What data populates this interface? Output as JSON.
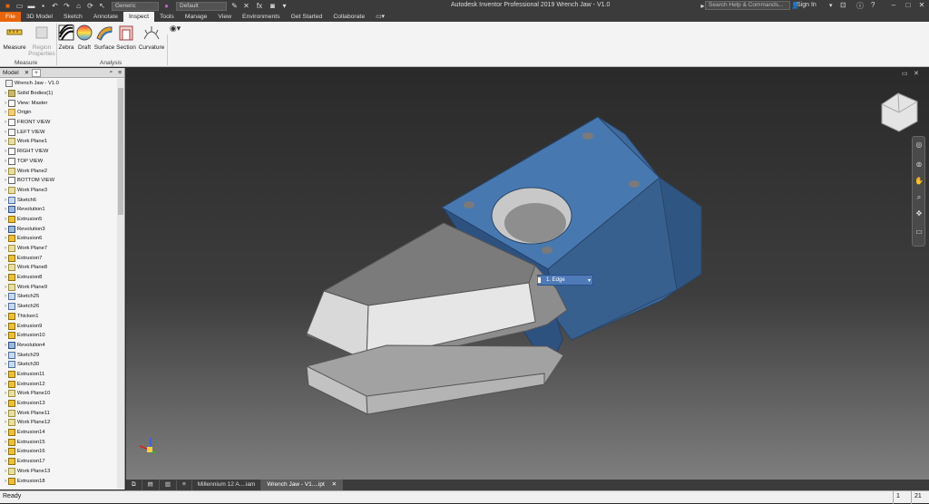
{
  "titlebar": {
    "app_title": "Autodesk Inventor Professional 2019   Wrench Jaw - V1.0",
    "appearance_combo": "Generic",
    "material_combo": "Default",
    "search_placeholder": "Search Help & Commands...",
    "signin": "Sign In"
  },
  "ribbon_tabs": [
    "3D Model",
    "Sketch",
    "Annotate",
    "Inspect",
    "Tools",
    "Manage",
    "View",
    "Environments",
    "Get Started",
    "Collaborate"
  ],
  "file_tab": "File",
  "ribbon": {
    "measure": "Measure",
    "region_properties_1": "Region",
    "region_properties_2": "Properties",
    "zebra": "Zebra",
    "draft": "Draft",
    "surface": "Surface",
    "section": "Section",
    "curvature": "Curvature",
    "group_measure": "Measure",
    "group_analysis": "Analysis"
  },
  "browser": {
    "tab": "Model",
    "add": "+",
    "items": [
      {
        "label": "Wrench Jaw - V1.0",
        "icon": "part",
        "indent": 0
      },
      {
        "label": "Solid Bodies(1)",
        "icon": "body",
        "indent": 1
      },
      {
        "label": "View: Master",
        "icon": "view",
        "indent": 1
      },
      {
        "label": "Origin",
        "icon": "folder",
        "indent": 1
      },
      {
        "label": "FRONT VIEW",
        "icon": "view",
        "indent": 1
      },
      {
        "label": "LEFT VIEW",
        "icon": "view",
        "indent": 1
      },
      {
        "label": "Work Plane1",
        "icon": "plane",
        "indent": 1
      },
      {
        "label": "RIGHT VIEW",
        "icon": "view",
        "indent": 1
      },
      {
        "label": "TOP VIEW",
        "icon": "view",
        "indent": 1
      },
      {
        "label": "Work Plane2",
        "icon": "plane",
        "indent": 1
      },
      {
        "label": "BOTTOM VIEW",
        "icon": "view",
        "indent": 1
      },
      {
        "label": "Work Plane3",
        "icon": "plane",
        "indent": 1
      },
      {
        "label": "Sketch6",
        "icon": "sketch",
        "indent": 1
      },
      {
        "label": "Revolution1",
        "icon": "revolve",
        "indent": 1
      },
      {
        "label": "Extrusion5",
        "icon": "feature",
        "indent": 1
      },
      {
        "label": "Revolution3",
        "icon": "revolve",
        "indent": 1
      },
      {
        "label": "Extrusion6",
        "icon": "feature",
        "indent": 1
      },
      {
        "label": "Work Plane7",
        "icon": "plane",
        "indent": 1
      },
      {
        "label": "Extrusion7",
        "icon": "feature",
        "indent": 1
      },
      {
        "label": "Work Plane8",
        "icon": "plane",
        "indent": 1
      },
      {
        "label": "Extrusion8",
        "icon": "feature",
        "indent": 1
      },
      {
        "label": "Work Plane9",
        "icon": "plane",
        "indent": 1
      },
      {
        "label": "Sketch25",
        "icon": "sketch",
        "indent": 1
      },
      {
        "label": "Sketch26",
        "icon": "sketch",
        "indent": 1
      },
      {
        "label": "Thicken1",
        "icon": "feature",
        "indent": 1
      },
      {
        "label": "Extrusion9",
        "icon": "feature",
        "indent": 1
      },
      {
        "label": "Extrusion10",
        "icon": "feature",
        "indent": 1
      },
      {
        "label": "Revolution4",
        "icon": "revolve",
        "indent": 1
      },
      {
        "label": "Sketch29",
        "icon": "sketch",
        "indent": 1
      },
      {
        "label": "Sketch30",
        "icon": "sketch",
        "indent": 1
      },
      {
        "label": "Extrusion11",
        "icon": "feature",
        "indent": 1
      },
      {
        "label": "Extrusion12",
        "icon": "feature",
        "indent": 1
      },
      {
        "label": "Work Plane10",
        "icon": "plane",
        "indent": 1
      },
      {
        "label": "Extrusion13",
        "icon": "feature",
        "indent": 1
      },
      {
        "label": "Work Plane11",
        "icon": "plane",
        "indent": 1
      },
      {
        "label": "Work Plane12",
        "icon": "plane",
        "indent": 1
      },
      {
        "label": "Extrusion14",
        "icon": "feature",
        "indent": 1
      },
      {
        "label": "Extrusion15",
        "icon": "feature",
        "indent": 1
      },
      {
        "label": "Extrusion16",
        "icon": "feature",
        "indent": 1
      },
      {
        "label": "Extrusion17",
        "icon": "feature",
        "indent": 1
      },
      {
        "label": "Work Plane13",
        "icon": "plane",
        "indent": 1
      },
      {
        "label": "Extrusion18",
        "icon": "feature",
        "indent": 1
      }
    ]
  },
  "viewport": {
    "selection_label": "1. Edge"
  },
  "doc_tabs": [
    "Millennium 12 A....iam",
    "Wrench Jaw - V1....ipt"
  ],
  "status": {
    "text": "Ready",
    "count1": "1",
    "count2": "21"
  },
  "colors": {
    "file_tab": "#e8650b",
    "part_blue": "#3f6a9e",
    "part_grey": "#9a9a9a"
  }
}
